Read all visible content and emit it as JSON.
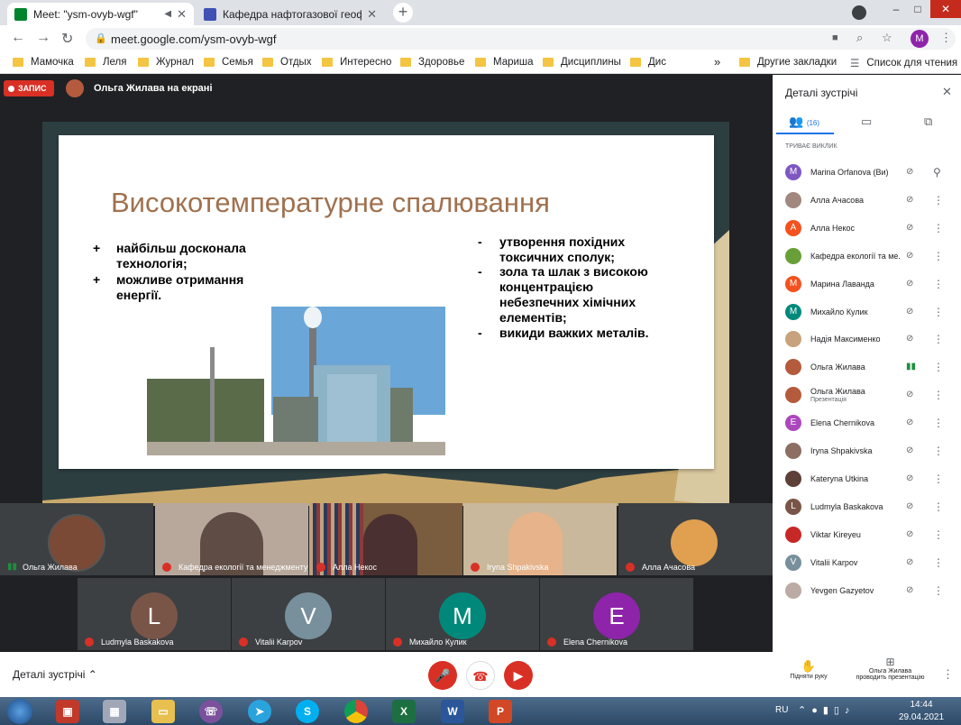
{
  "browser": {
    "tabs": [
      {
        "title": "Meet: \"ysm-ovyb-wgf\"",
        "active": true
      },
      {
        "title": "Кафедра нафтогазової геофізи",
        "active": false
      }
    ],
    "new_tab": "+",
    "url": "meet.google.com/ysm-ovyb-wgf",
    "profile_initial": "M",
    "bookmarks": [
      "Мамочка",
      "Леля",
      "Журнал",
      "Семья",
      "Отдых",
      "Интересно",
      "Здоровье",
      "Мариша",
      "Дисциплины",
      "Дис"
    ],
    "bookmarks_more": "»",
    "other_bookmarks": "Другие закладки",
    "reading_list": "Список для чтения"
  },
  "meet": {
    "recording_label": "ЗАПИС",
    "presenter_label": "Ольга Жилава на екрані"
  },
  "slide": {
    "title": "Високотемпературне спалювання",
    "pros": [
      {
        "marker": "+",
        "text": "найбільш досконала технологія;"
      },
      {
        "marker": "+",
        "text": "можливе отримання енергії."
      }
    ],
    "cons": [
      {
        "marker": "-",
        "text": "утворення похідних токсичних сполук;"
      },
      {
        "marker": "-",
        "text": "зола та шлак з високою концентрацією небезпечних хімічних елементів;"
      },
      {
        "marker": "-",
        "text": "викиди важких металів."
      }
    ]
  },
  "tiles_row1": [
    {
      "name": "Ольга Жилава",
      "speaking": true
    },
    {
      "name": "Кафедра екології та менеджменту ..."
    },
    {
      "name": "Алла Некос"
    },
    {
      "name": "Iryna Shpakivska"
    },
    {
      "name": "Алла Ачасова"
    }
  ],
  "tiles_row2": [
    {
      "name": "Ludmyla Baskakova",
      "letter": "L",
      "color": "#795548"
    },
    {
      "name": "Vitalii Karpov",
      "letter": "V",
      "color": "#78909c"
    },
    {
      "name": "Михайло Кулик",
      "letter": "M",
      "color": "#00897b"
    },
    {
      "name": "Elena Chernikova",
      "letter": "E",
      "color": "#8e24aa"
    }
  ],
  "bottom": {
    "details_label": "Деталі зустрічі",
    "raise_hand": "Підняти руку",
    "presenting_line1": "Ольга Жилава",
    "presenting_line2": "проводить презентацію"
  },
  "panel": {
    "title": "Деталі зустрічі",
    "people_count": "(16)",
    "section": "ТРИВАЄ ВИКЛИК",
    "participants": [
      {
        "name": "Marina Orfanova (Ви)",
        "letter": "M",
        "color": "#7e57c2",
        "pin": true
      },
      {
        "name": "Алла Ачасова",
        "letter": "",
        "color": "#a1887f"
      },
      {
        "name": "Алла Некос",
        "letter": "А",
        "color": "#f4511e"
      },
      {
        "name": "Кафедра екології та ме...",
        "letter": "",
        "color": "#689f38"
      },
      {
        "name": "Марина Лаванда",
        "letter": "М",
        "color": "#f4511e"
      },
      {
        "name": "Михайло Кулик",
        "letter": "М",
        "color": "#00897b"
      },
      {
        "name": "Надія Максименко",
        "letter": "",
        "color": "#c8a27c"
      },
      {
        "name": "Ольга Жилава",
        "letter": "",
        "color": "#b45b3e",
        "speaking": true
      },
      {
        "name": "Ольга Жилава",
        "sub": "Презентація",
        "letter": "",
        "color": "#b45b3e"
      },
      {
        "name": "Elena Chernikova",
        "letter": "E",
        "color": "#ab47bc"
      },
      {
        "name": "Iryna Shpakivska",
        "letter": "",
        "color": "#8d6e63"
      },
      {
        "name": "Kateryna Utkina",
        "letter": "",
        "color": "#5d4037"
      },
      {
        "name": "Ludmyla Baskakova",
        "letter": "L",
        "color": "#795548"
      },
      {
        "name": "Viktar Kireyeu",
        "letter": "",
        "color": "#c62828"
      },
      {
        "name": "Vitalii Karpov",
        "letter": "V",
        "color": "#78909c"
      },
      {
        "name": "Yevgen Gazyetov",
        "letter": "",
        "color": "#bcaaa4"
      }
    ]
  },
  "taskbar": {
    "lang": "RU",
    "time": "14:44",
    "date": "29.04.2021"
  }
}
